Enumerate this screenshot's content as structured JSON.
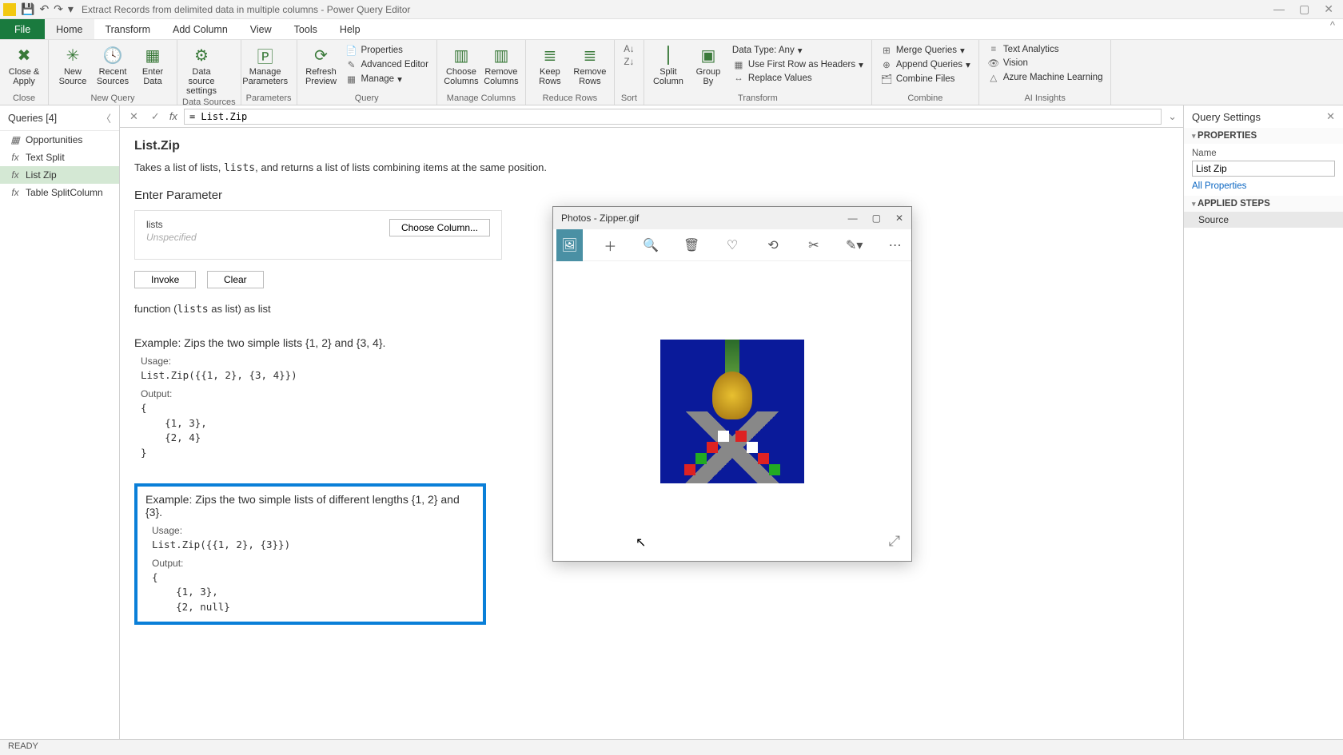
{
  "titlebar": {
    "title": "Extract Records from delimited data in multiple columns - Power Query Editor"
  },
  "tabs": {
    "file": "File",
    "home": "Home",
    "transform": "Transform",
    "addcol": "Add Column",
    "view": "View",
    "tools": "Tools",
    "help": "Help"
  },
  "ribbon": {
    "close": {
      "label": "Close &\nApply",
      "group": "Close"
    },
    "newsource": "New\nSource",
    "recentsources": "Recent\nSources",
    "enterdata": "Enter\nData",
    "newquery_group": "New Query",
    "datasourcesettings": "Data source\nsettings",
    "datasources_group": "Data Sources",
    "manageparams": "Manage\nParameters",
    "parameters_group": "Parameters",
    "refresh": "Refresh\nPreview",
    "properties": "Properties",
    "advancededitor": "Advanced Editor",
    "manage": "Manage",
    "query_group": "Query",
    "choosecols": "Choose\nColumns",
    "removecols": "Remove\nColumns",
    "managecols_group": "Manage Columns",
    "keeprows": "Keep\nRows",
    "removerows": "Remove\nRows",
    "reducerows_group": "Reduce Rows",
    "sort_group": "Sort",
    "splitcol": "Split\nColumn",
    "groupby": "Group\nBy",
    "datatype": "Data Type: Any",
    "firstrowheaders": "Use First Row as Headers",
    "replacevalues": "Replace Values",
    "transform_group": "Transform",
    "mergequeries": "Merge Queries",
    "appendqueries": "Append Queries",
    "combinefiles": "Combine Files",
    "combine_group": "Combine",
    "textanalytics": "Text Analytics",
    "vision": "Vision",
    "azureml": "Azure Machine Learning",
    "ai_group": "AI Insights"
  },
  "queries": {
    "header": "Queries [4]",
    "items": [
      {
        "icon": "▦",
        "label": "Opportunities"
      },
      {
        "icon": "fx",
        "label": "Text Split"
      },
      {
        "icon": "fx",
        "label": "List Zip"
      },
      {
        "icon": "fx",
        "label": "Table SplitColumn"
      }
    ]
  },
  "formula": "= List.Zip",
  "doc": {
    "fn_name": "List.Zip",
    "desc_pre": "Takes a list of lists, ",
    "desc_code": "lists",
    "desc_post": ", and returns a list of lists combining items at the same position.",
    "enter_param": "Enter Parameter",
    "param_name": "lists",
    "param_hint": "Unspecified",
    "choose_col": "Choose Column...",
    "invoke": "Invoke",
    "clear": "Clear",
    "sig_pre": "function (",
    "sig_code": "lists",
    "sig_post": " as list) as list",
    "ex1": {
      "title": "Example: Zips the two simple lists {1, 2} and {3, 4}.",
      "usage_label": "Usage:",
      "usage": "List.Zip({{1, 2}, {3, 4}})",
      "output_label": "Output:",
      "output": "{\n    {1, 3},\n    {2, 4}\n}"
    },
    "ex2": {
      "title": "Example: Zips the two simple lists of different lengths {1, 2} and {3}.",
      "usage_label": "Usage:",
      "usage": "List.Zip({{1, 2}, {3}})",
      "output_label": "Output:",
      "output": "{\n    {1, 3},\n    {2, null}"
    }
  },
  "settings": {
    "header": "Query Settings",
    "properties": "PROPERTIES",
    "name_label": "Name",
    "name_value": "List Zip",
    "all_props": "All Properties",
    "applied_steps": "APPLIED STEPS",
    "step1": "Source"
  },
  "status": "READY",
  "photos": {
    "title": "Photos - Zipper.gif"
  }
}
